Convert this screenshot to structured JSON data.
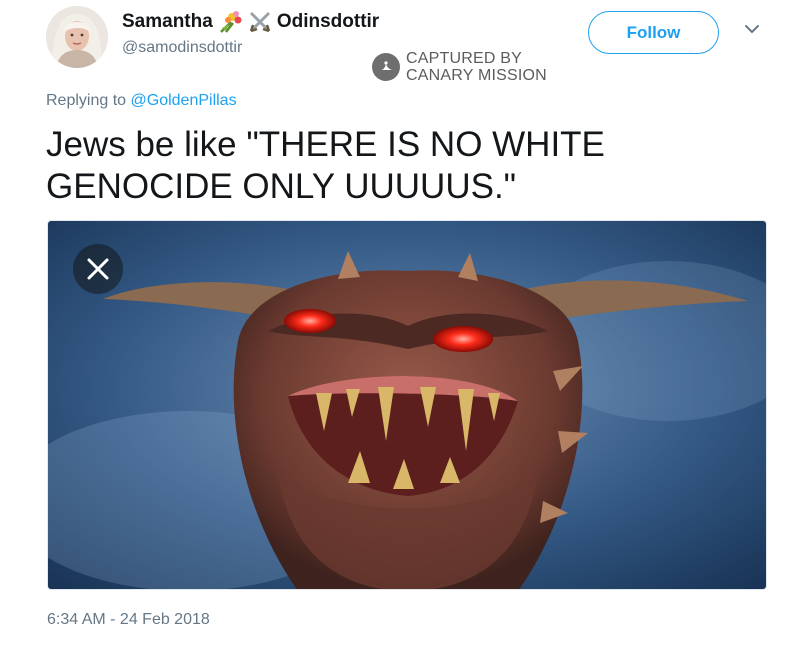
{
  "tweet": {
    "author": {
      "name_first": "Samantha",
      "name_last": "Odinsdottir",
      "handle": "@samodinsdottir",
      "emoji_icons": [
        "bouquet-icon",
        "crossed-swords-icon"
      ]
    },
    "follow_label": "Follow",
    "replying_prefix": "Replying to",
    "replying_handle": "@GoldenPillas",
    "text": "Jews be like \"THERE IS NO WHITE GENOCIDE ONLY UUUUUS.\"",
    "timestamp": "6:34 AM - 24 Feb 2018"
  },
  "watermark": {
    "line1": "CAPTURED BY",
    "line2": "CANARY MISSION"
  },
  "colors": {
    "accent": "#1da1f2",
    "secondary_text": "#657786",
    "primary_text": "#14171a",
    "watermark": "#5c5c5c"
  }
}
